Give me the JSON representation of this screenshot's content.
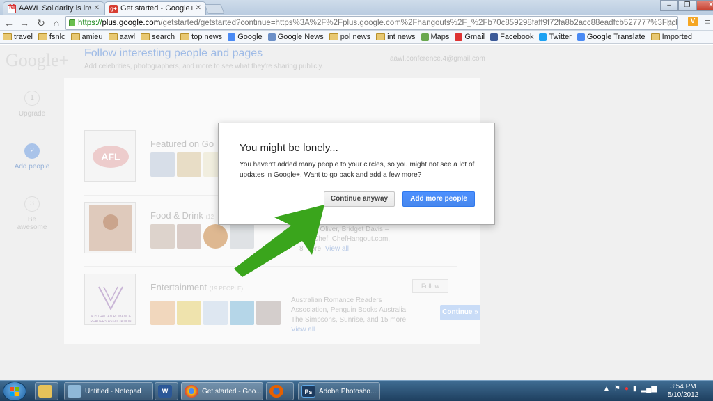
{
  "browser": {
    "tabs": [
      {
        "title": "AAWL Solidarity is inviting",
        "icon": "gmail-icon",
        "active": false
      },
      {
        "title": "Get started - Google+",
        "icon": "google-plus-icon",
        "active": true
      }
    ],
    "url": {
      "scheme": "https://",
      "host": "plus.google.com",
      "path": "/getstarted/getstarted?continue=https%3A%2F%2Fplus.google.com%2Fhangouts%2F_%2Fb70c859298faff9f72fa8b2acc88eadfcb527777%3Fhcb%3"
    },
    "bookmarks": [
      {
        "label": "travel",
        "icon": "folder-icon"
      },
      {
        "label": "fsnlc",
        "icon": "folder-icon"
      },
      {
        "label": "amieu",
        "icon": "folder-icon"
      },
      {
        "label": "aawl",
        "icon": "folder-icon"
      },
      {
        "label": "search",
        "icon": "folder-icon"
      },
      {
        "label": "top news",
        "icon": "folder-icon"
      },
      {
        "label": "Google",
        "icon": "google-icon"
      },
      {
        "label": "Google News",
        "icon": "google-news-icon"
      },
      {
        "label": "pol news",
        "icon": "folder-icon"
      },
      {
        "label": "int news",
        "icon": "folder-icon"
      },
      {
        "label": "Maps",
        "icon": "maps-icon"
      },
      {
        "label": "Gmail",
        "icon": "gmail-icon"
      },
      {
        "label": "Facebook",
        "icon": "facebook-icon"
      },
      {
        "label": "Twitter",
        "icon": "twitter-icon"
      },
      {
        "label": "Google Translate",
        "icon": "translate-icon"
      },
      {
        "label": "Imported",
        "icon": "folder-icon"
      }
    ]
  },
  "page": {
    "logo": "Google+",
    "account": "aawl.conference.4@gmail.com",
    "steps": [
      {
        "num": "1",
        "label": "Upgrade"
      },
      {
        "num": "2",
        "label": "Add people"
      },
      {
        "num": "3",
        "label": "Be awesome"
      }
    ],
    "title": "Follow interesting people and pages",
    "subtitle": "Add celebrities, photographers, and more to see what they're sharing publicly.",
    "categories": [
      {
        "name": "Featured on Go",
        "count": "",
        "desc": []
      },
      {
        "name": "Food & Drink",
        "count": "(12",
        "desc": [
          "Jamie Oliver, Bridget Davis –",
          "rnet Chef, ChefHangout.com,",
          "8 more."
        ],
        "view_all": "View all"
      },
      {
        "name": "Entertainment",
        "count": "(19 PEOPLE)",
        "desc": [
          "Australian Romance Readers",
          "Association, Penguin Books Australia,",
          "The Simpsons, Sunrise, and 15 more."
        ],
        "view_all": "View all"
      }
    ],
    "follow_label": "Follow",
    "continue_label": "Continue »"
  },
  "dialog": {
    "title": "You might be lonely...",
    "body": "You haven't added many people to your circles, so you might not see a lot of updates in Google+. Want to go back and add a few more?",
    "continue_anyway": "Continue anyway",
    "add_more": "Add more people"
  },
  "taskbar": {
    "items": [
      {
        "label": "Untitled - Notepad",
        "icon": "notepad-icon"
      },
      {
        "label": "",
        "icon": "word-icon"
      },
      {
        "label": "Get started - Goo...",
        "icon": "chrome-icon"
      },
      {
        "label": "",
        "icon": "firefox-icon"
      },
      {
        "label": "Adobe Photosho...",
        "icon": "photoshop-icon"
      }
    ],
    "time": "3:54 PM",
    "date": "5/10/2012"
  },
  "colors": {
    "accent_blue": "#4d90fe",
    "gplus_red": "#d73d32",
    "arrow_green": "#3aa51c"
  }
}
